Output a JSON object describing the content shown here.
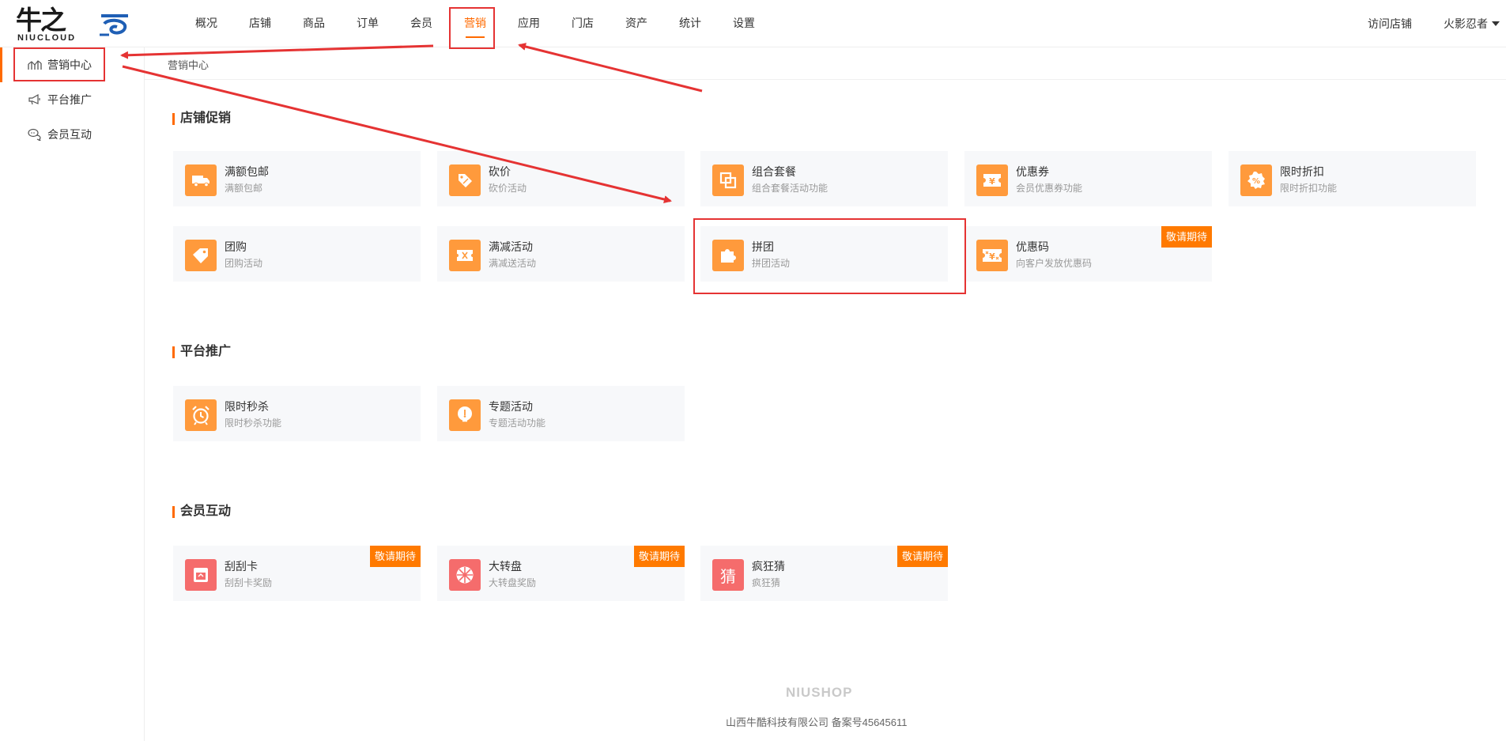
{
  "header": {
    "logo_cn_main": "牛之",
    "logo_cn_last": "云",
    "logo_en": "NIUCLOUD",
    "nav": [
      {
        "label": "概况",
        "active": false
      },
      {
        "label": "店铺",
        "active": false
      },
      {
        "label": "商品",
        "active": false
      },
      {
        "label": "订单",
        "active": false
      },
      {
        "label": "会员",
        "active": false
      },
      {
        "label": "营销",
        "active": true
      },
      {
        "label": "应用",
        "active": false
      },
      {
        "label": "门店",
        "active": false
      },
      {
        "label": "资产",
        "active": false
      },
      {
        "label": "统计",
        "active": false
      },
      {
        "label": "设置",
        "active": false
      }
    ],
    "visit_shop": "访问店铺",
    "user_name": "火影忍者"
  },
  "sidebar": {
    "items": [
      {
        "label": "营销中心",
        "icon": "chart-icon",
        "active": true
      },
      {
        "label": "平台推广",
        "icon": "megaphone-icon",
        "active": false
      },
      {
        "label": "会员互动",
        "icon": "chat-icon",
        "active": false
      }
    ]
  },
  "breadcrumb": "营销中心",
  "sections": {
    "store_promo": {
      "title": "店铺促销",
      "cards": [
        {
          "name": "满额包邮",
          "desc": "满额包邮",
          "icon": "truck-icon"
        },
        {
          "name": "砍价",
          "desc": "砍价活动",
          "icon": "price-tag-icon"
        },
        {
          "name": "组合套餐",
          "desc": "组合套餐活动功能",
          "icon": "bundle-icon"
        },
        {
          "name": "优惠券",
          "desc": "会员优惠券功能",
          "icon": "coupon-icon"
        },
        {
          "name": "限时折扣",
          "desc": "限时折扣功能",
          "icon": "discount-icon"
        },
        {
          "name": "团购",
          "desc": "团购活动",
          "icon": "tag-icon"
        },
        {
          "name": "满减活动",
          "desc": "满减送活动",
          "icon": "ticket-icon"
        },
        {
          "name": "拼团",
          "desc": "拼团活动",
          "icon": "puzzle-icon"
        },
        {
          "name": "优惠码",
          "desc": "向客户发放优惠码",
          "icon": "coupon-code-icon",
          "badge": "敬请期待"
        }
      ]
    },
    "platform_promo": {
      "title": "平台推广",
      "cards": [
        {
          "name": "限时秒杀",
          "desc": "限时秒杀功能",
          "icon": "alarm-clock-icon"
        },
        {
          "name": "专题活动",
          "desc": "专题活动功能",
          "icon": "bulb-icon"
        }
      ]
    },
    "member_interact": {
      "title": "会员互动",
      "cards": [
        {
          "name": "刮刮卡",
          "desc": "刮刮卡奖励",
          "icon": "scratch-card-icon",
          "badge": "敬请期待"
        },
        {
          "name": "大转盘",
          "desc": "大转盘奖励",
          "icon": "wheel-icon",
          "badge": "敬请期待"
        },
        {
          "name": "疯狂猜",
          "desc": "疯狂猜",
          "icon": "guess-icon",
          "icon_text": "猜",
          "badge": "敬请期待"
        }
      ]
    }
  },
  "footer": {
    "brand": "NIUSHOP",
    "company": "山西牛酷科技有限公司  备案号45645611"
  },
  "colors": {
    "accent": "#ff6a00",
    "icon_orange": "#ff9a3c",
    "icon_red": "#f56c6c",
    "badge": "#ff7a00",
    "annotation": "#e53333"
  }
}
